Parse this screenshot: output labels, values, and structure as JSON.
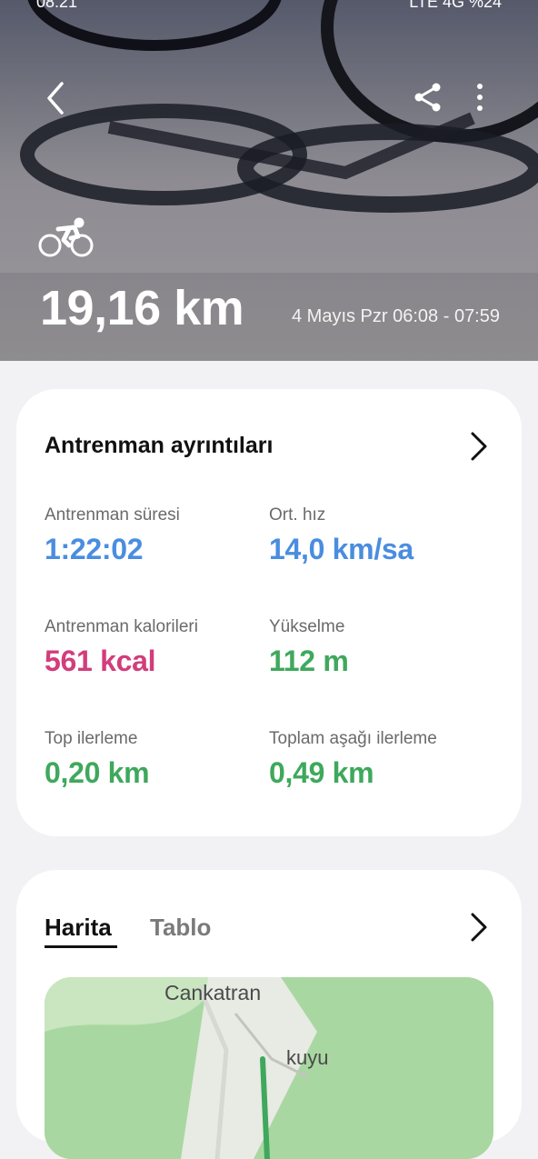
{
  "status_bar": {
    "time": "08:21",
    "indicators": "LTE 4G %24"
  },
  "header": {
    "activity_icon": "cycling-icon",
    "distance": "19,16 km",
    "date_time": "4 Mayıs Pzr 06:08 - 07:59"
  },
  "details": {
    "title": "Antrenman ayrıntıları",
    "stats": [
      {
        "label": "Antrenman süresi",
        "value": "1:22:02",
        "color": "#4a8de0"
      },
      {
        "label": "Ort. hız",
        "value": "14,0 km/sa",
        "color": "#4a8de0"
      },
      {
        "label": "Antrenman kalorileri",
        "value": "561 kcal",
        "color": "#d23d7b"
      },
      {
        "label": "Yükselme",
        "value": "112 m",
        "color": "#3fa85c"
      },
      {
        "label": "Top ilerleme",
        "value": "0,20 km",
        "color": "#3fa85c"
      },
      {
        "label": "Toplam aşağı ilerleme",
        "value": "0,49 km",
        "color": "#3fa85c"
      }
    ]
  },
  "map_section": {
    "tabs": [
      {
        "label": "Harita"
      },
      {
        "label": "Tablo"
      }
    ],
    "map_labels": [
      "Cankatran",
      "kuyu"
    ]
  }
}
